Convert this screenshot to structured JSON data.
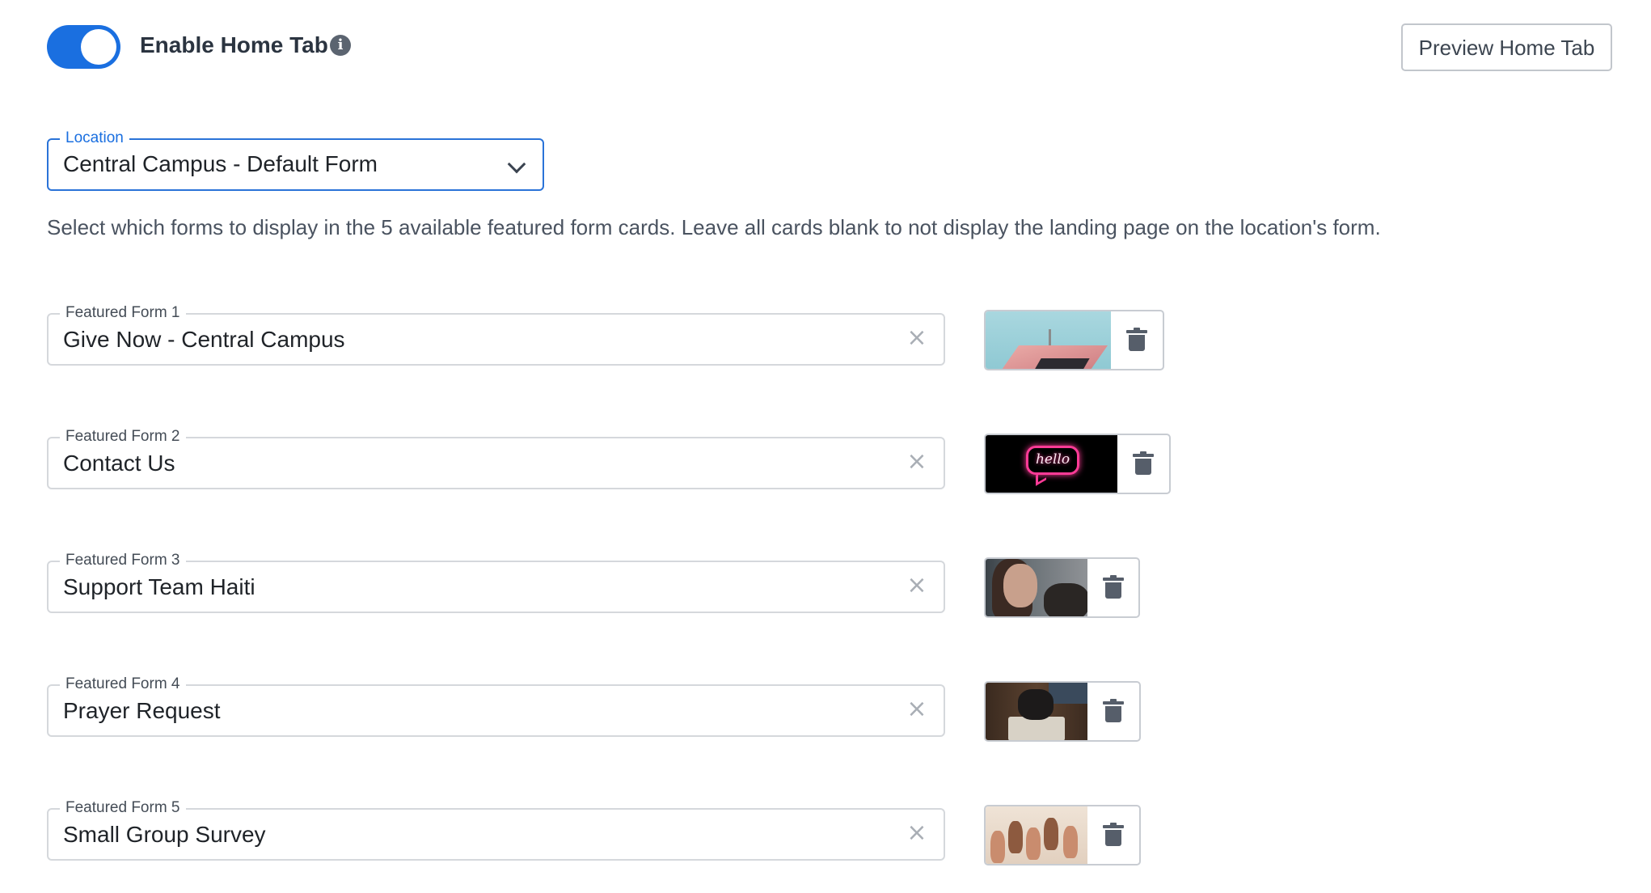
{
  "header": {
    "toggle_on": true,
    "enable_label": "Enable Home Tab",
    "info_icon": "info-icon",
    "preview_button": "Preview Home Tab"
  },
  "location": {
    "label": "Location",
    "value": "Central Campus - Default Form"
  },
  "description": "Select which forms to display in the 5 available featured form cards. Leave all cards blank to not display the landing page on the location's form.",
  "featured_forms": [
    {
      "label": "Featured Form 1",
      "value": "Give Now - Central Campus",
      "image": "church-steeple-sky"
    },
    {
      "label": "Featured Form 2",
      "value": "Contact Us",
      "image": "neon-hello-sign"
    },
    {
      "label": "Featured Form 3",
      "value": "Support Team Haiti",
      "image": "smiling-people"
    },
    {
      "label": "Featured Form 4",
      "value": "Prayer Request",
      "image": "praying-hands-bible"
    },
    {
      "label": "Featured Form 5",
      "value": "Small Group Survey",
      "image": "raised-hands"
    }
  ],
  "colors": {
    "accent": "#1a6fe0",
    "border": "#d5d8dc",
    "muted_text": "#4a5360"
  }
}
